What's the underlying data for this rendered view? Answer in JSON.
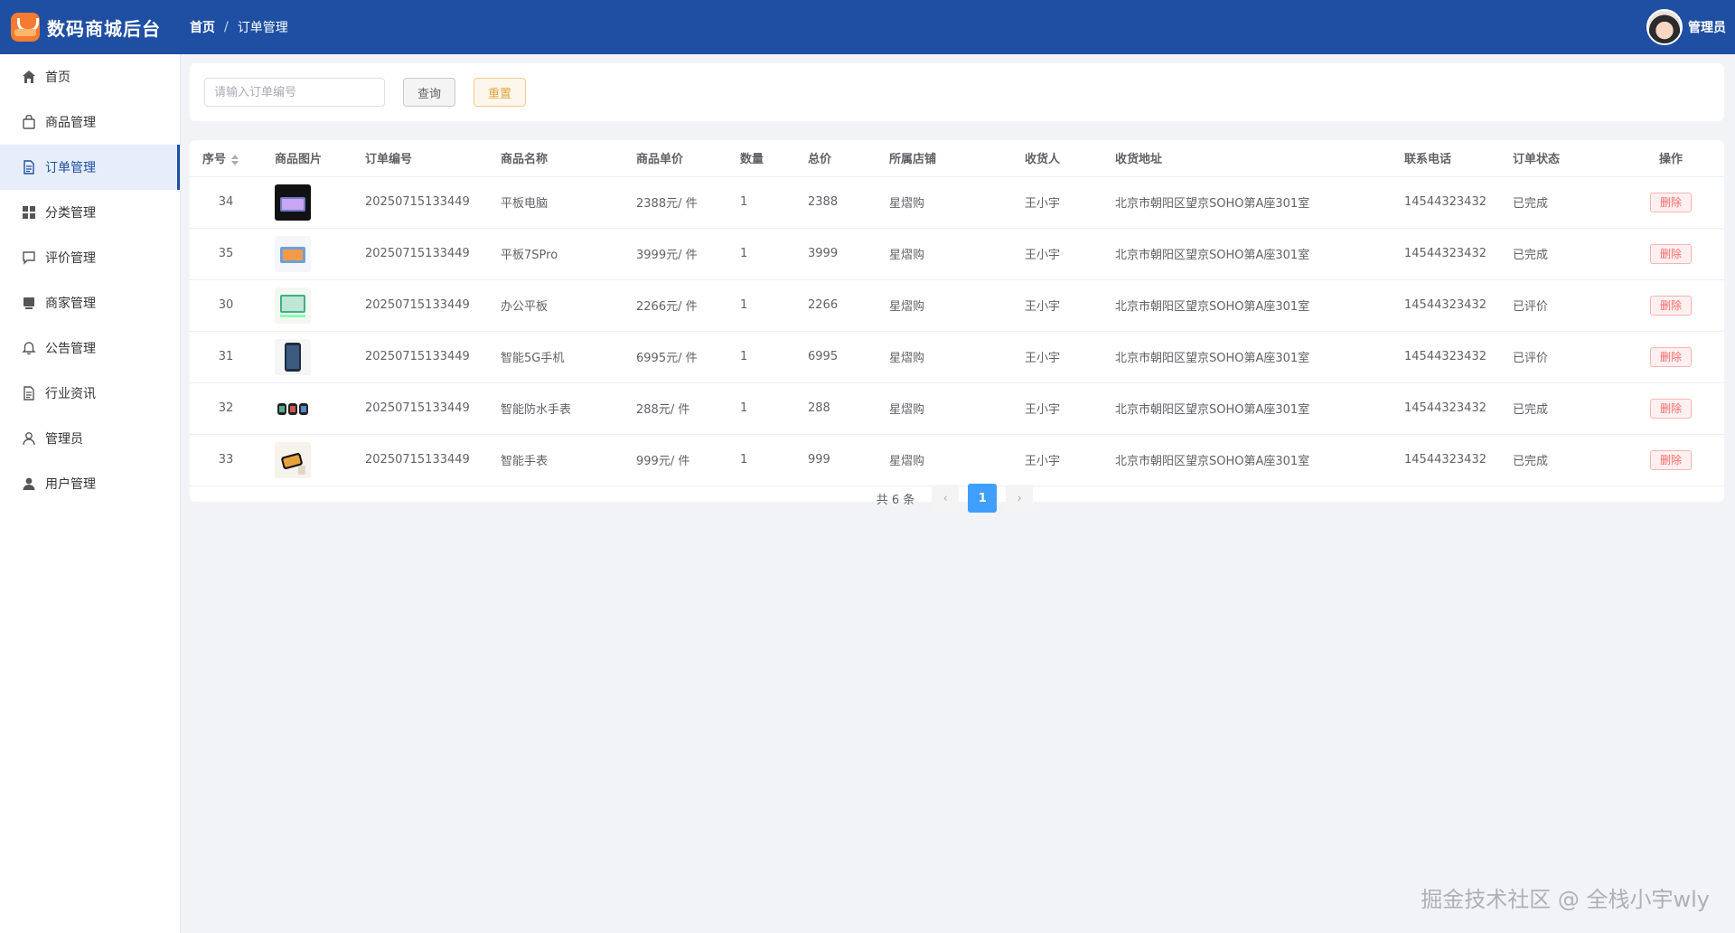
{
  "brand": {
    "title": "数码商城后台"
  },
  "breadcrumb": {
    "home": "首页",
    "separator": "/",
    "current": "订单管理"
  },
  "user": {
    "name": "管理员"
  },
  "sidebar": {
    "items": [
      {
        "label": "首页",
        "icon": "home-icon"
      },
      {
        "label": "商品管理",
        "icon": "shopping-bag-icon"
      },
      {
        "label": "订单管理",
        "icon": "document-icon",
        "active": true
      },
      {
        "label": "分类管理",
        "icon": "grid-icon"
      },
      {
        "label": "评价管理",
        "icon": "comment-icon"
      },
      {
        "label": "商家管理",
        "icon": "store-icon"
      },
      {
        "label": "公告管理",
        "icon": "bell-icon"
      },
      {
        "label": "行业资讯",
        "icon": "news-icon"
      },
      {
        "label": "管理员",
        "icon": "user-icon"
      },
      {
        "label": "用户管理",
        "icon": "user-filled-icon"
      }
    ]
  },
  "search": {
    "placeholder": "请输入订单编号",
    "value": "",
    "query_label": "查询",
    "reset_label": "重置"
  },
  "table": {
    "columns": [
      "序号",
      "商品图片",
      "订单编号",
      "商品名称",
      "商品单价",
      "数量",
      "总价",
      "所属店铺",
      "收货人",
      "收货地址",
      "联系电话",
      "订单状态",
      "操作"
    ],
    "rows": [
      {
        "id": "34",
        "image": "tablet-dark",
        "order_no": "20250715133449",
        "name": "平板电脑",
        "price": "2388元/ 件",
        "qty": "1",
        "total": "2388",
        "shop": "星熠购",
        "receiver": "王小宇",
        "address": "北京市朝阳区望京SOHO第A座301室",
        "phone": "14544323432",
        "status": "已完成",
        "action": "删除"
      },
      {
        "id": "35",
        "image": "tablet-orange",
        "order_no": "20250715133449",
        "name": "平板7SPro",
        "price": "3999元/ 件",
        "qty": "1",
        "total": "3999",
        "shop": "星熠购",
        "receiver": "王小宇",
        "address": "北京市朝阳区望京SOHO第A座301室",
        "phone": "14544323432",
        "status": "已完成",
        "action": "删除"
      },
      {
        "id": "30",
        "image": "tablet-green",
        "order_no": "20250715133449",
        "name": "办公平板",
        "price": "2266元/ 件",
        "qty": "1",
        "total": "2266",
        "shop": "星熠购",
        "receiver": "王小宇",
        "address": "北京市朝阳区望京SOHO第A座301室",
        "phone": "14544323432",
        "status": "已评价",
        "action": "删除"
      },
      {
        "id": "31",
        "image": "phone-dark",
        "order_no": "20250715133449",
        "name": "智能5G手机",
        "price": "6995元/ 件",
        "qty": "1",
        "total": "6995",
        "shop": "星熠购",
        "receiver": "王小宇",
        "address": "北京市朝阳区望京SOHO第A座301室",
        "phone": "14544323432",
        "status": "已评价",
        "action": "删除"
      },
      {
        "id": "32",
        "image": "watches",
        "order_no": "20250715133449",
        "name": "智能防水手表",
        "price": "288元/ 件",
        "qty": "1",
        "total": "288",
        "shop": "星熠购",
        "receiver": "王小宇",
        "address": "北京市朝阳区望京SOHO第A座301室",
        "phone": "14544323432",
        "status": "已完成",
        "action": "删除"
      },
      {
        "id": "33",
        "image": "watch-single",
        "order_no": "20250715133449",
        "name": "智能手表",
        "price": "999元/ 件",
        "qty": "1",
        "total": "999",
        "shop": "星熠购",
        "receiver": "王小宇",
        "address": "北京市朝阳区望京SOHO第A座301室",
        "phone": "14544323432",
        "status": "已完成",
        "action": "删除"
      }
    ]
  },
  "pagination": {
    "total_text": "共 6 条",
    "current_page": "1",
    "prev": "‹",
    "next": "›"
  },
  "watermark": "掘金技术社区 @ 全栈小宇wly",
  "colors": {
    "header": "#1e4fa3",
    "accent": "#409eff",
    "danger": "#f56c6c",
    "warning": "#e6a23c"
  }
}
